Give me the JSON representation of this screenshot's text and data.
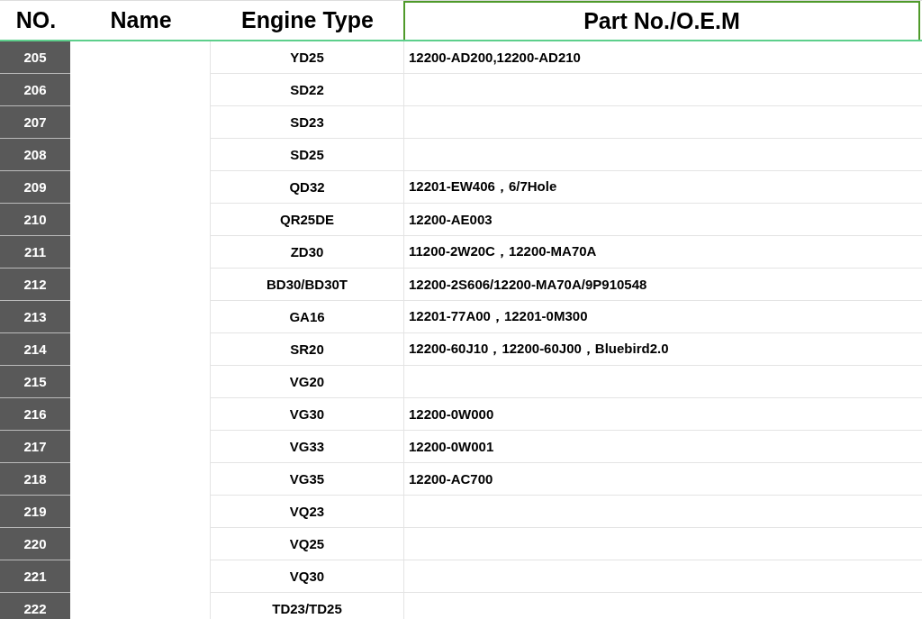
{
  "table": {
    "columns": [
      "NO.",
      "Name",
      "Engine Type",
      "Part No./O.E.M"
    ],
    "rows": [
      {
        "no": "205",
        "engine": "YD25",
        "part": "12200-AD200,12200-AD210"
      },
      {
        "no": "206",
        "engine": "SD22",
        "part": ""
      },
      {
        "no": "207",
        "engine": "SD23",
        "part": ""
      },
      {
        "no": "208",
        "engine": "SD25",
        "part": ""
      },
      {
        "no": "209",
        "engine": "QD32",
        "part": "12201-EW406，6/7Hole"
      },
      {
        "no": "210",
        "engine": "QR25DE",
        "part": "12200-AE003"
      },
      {
        "no": "211",
        "engine": "ZD30",
        "part": "11200-2W20C，12200-MA70A"
      },
      {
        "no": "212",
        "engine": "BD30/BD30T",
        "part": "12200-2S606/12200-MA70A/9P910548"
      },
      {
        "no": "213",
        "engine": "GA16",
        "part": "12201-77A00，12201-0M300"
      },
      {
        "no": "214",
        "engine": "SR20",
        "part": "12200-60J10，12200-60J00，Bluebird2.0"
      },
      {
        "no": "215",
        "engine": "VG20",
        "part": ""
      },
      {
        "no": "216",
        "engine": "VG30",
        "part": "12200-0W000"
      },
      {
        "no": "217",
        "engine": "VG33",
        "part": "12200-0W001"
      },
      {
        "no": "218",
        "engine": "VG35",
        "part": "12200-AC700"
      },
      {
        "no": "219",
        "engine": "VQ23",
        "part": ""
      },
      {
        "no": "220",
        "engine": "VQ25",
        "part": ""
      },
      {
        "no": "221",
        "engine": "VQ30",
        "part": ""
      },
      {
        "no": "222",
        "engine": "TD23/TD25",
        "part": ""
      }
    ]
  }
}
